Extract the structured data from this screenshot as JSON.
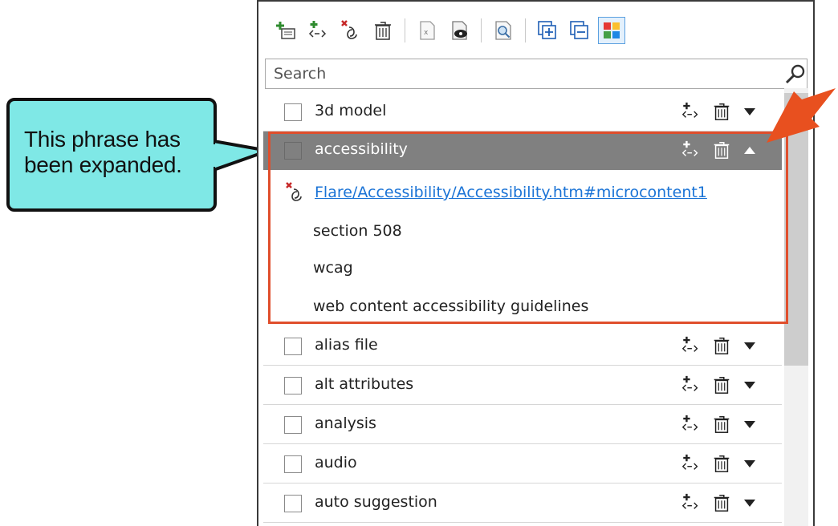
{
  "callout": {
    "line1": "This phrase has",
    "line2": "been expanded."
  },
  "toolbar": {
    "buttons": [
      {
        "icon": "add-phrase-icon"
      },
      {
        "icon": "add-alias-icon"
      },
      {
        "icon": "remove-link-icon"
      },
      {
        "icon": "delete-icon"
      },
      {
        "icon": "excel-file-icon"
      },
      {
        "icon": "preview-icon"
      },
      {
        "icon": "find-icon"
      },
      {
        "icon": "expand-all-icon"
      },
      {
        "icon": "collapse-all-icon"
      },
      {
        "icon": "color-grid-icon"
      }
    ]
  },
  "search": {
    "placeholder": "Search"
  },
  "rows": [
    {
      "label": "3d model"
    },
    {
      "label": "accessibility"
    },
    {
      "label": "alias file"
    },
    {
      "label": "alt attributes"
    },
    {
      "label": "analysis"
    },
    {
      "label": "audio"
    },
    {
      "label": "auto suggestion"
    }
  ],
  "expanded": {
    "link": "Flare/Accessibility/Accessibility.htm#microcontent1",
    "aliases": [
      "section 508",
      "wcag",
      "web content accessibility guidelines"
    ]
  },
  "colors": {
    "highlight": "#e04e2c",
    "callout": "#7fe8e6",
    "link": "#1a73d6",
    "expanded_row": "#808080"
  }
}
